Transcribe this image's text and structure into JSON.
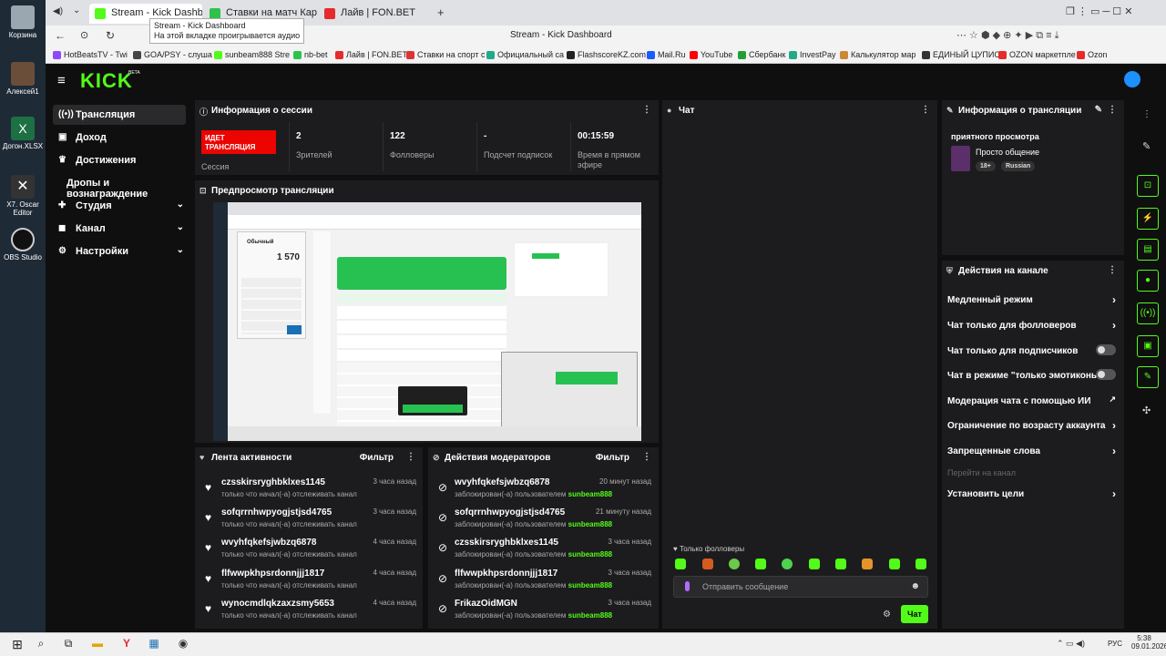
{
  "desktop": {
    "icons": [
      {
        "label": "Корзина"
      },
      {
        "label": "Алексей1"
      },
      {
        "label": "Догон.XLSX"
      },
      {
        "label": "X7. Oscar Editor"
      },
      {
        "label": "OBS Studio"
      }
    ]
  },
  "browser": {
    "tabs": [
      {
        "label": "Stream - Kick Dashboard"
      },
      {
        "label": "Ставки на матч Каролин"
      },
      {
        "label": "Лайв | FON.BET"
      }
    ],
    "tooltip": {
      "line1": "Stream - Kick Dashboard",
      "line2": "На этой вкладке проигрывается аудио"
    },
    "page_title": "Stream - Kick Dashboard",
    "bookmarks": [
      "HotBeatsTV - Twi",
      "GOA/PSY - слуша",
      "sunbeam888 Stre",
      "nb-bet",
      "Лайв | FON.BET",
      "Ставки на спорт с",
      "Официальный са",
      "FlashscoreKZ.com",
      "Mail.Ru",
      "YouTube",
      "Сбербанк",
      "InvestPay",
      "Калькулятор мар",
      "ЕДИНЫЙ ЦУПИС",
      "OZON маркетпле",
      "Ozon"
    ]
  },
  "colors": {
    "accent": "#53fc18",
    "live": "#eb0400",
    "panel": "#1c1c1e",
    "bg": "#0f0f10"
  },
  "kick": {
    "logo": "KICK",
    "logo_beta": "BETA",
    "nav": [
      {
        "label": "Трансляция",
        "icon": "broadcast-icon"
      },
      {
        "label": "Доход",
        "icon": "wallet-icon"
      },
      {
        "label": "Достижения",
        "icon": "trophy-icon"
      },
      {
        "label": "Дропы и вознаграждение",
        "icon": ""
      },
      {
        "label": "Студия",
        "icon": "studio-icon"
      },
      {
        "label": "Канал",
        "icon": "channel-icon"
      },
      {
        "label": "Настройки",
        "icon": "gear-icon"
      }
    ],
    "session": {
      "title": "Информация о сессии",
      "live_badge": "ИДЕТ ТРАНСЛЯЦИЯ",
      "session_label": "Сессия",
      "stats": [
        {
          "value": "2",
          "label": "Зрителей"
        },
        {
          "value": "122",
          "label": "Фолловеры"
        },
        {
          "value": "-",
          "label": "Подсчет подписок"
        },
        {
          "value": "00:15:59",
          "label": "Время в прямом эфире"
        }
      ]
    },
    "preview": {
      "title": "Предпросмотр трансляции",
      "calc_title": "Обычный",
      "calc_value": "1 570"
    },
    "chat": {
      "title": "Чат",
      "followers_only": "Только фолловеры",
      "placeholder": "Отправить сообщение",
      "send": "Чат"
    },
    "stream_info": {
      "title": "Информация о трансляции",
      "stream_title": "приятного просмотра",
      "category": "Просто общение",
      "tags": [
        "18+",
        "Russian"
      ]
    },
    "channel_actions": {
      "title": "Действия на канале",
      "items": [
        "Медленный режим",
        "Чат только для фолловеров",
        "Чат только для подписчиков",
        "Чат в режиме \"только эмотиконы\"",
        "Модерация чата с помощью ИИ",
        "Ограничение по возрасту аккаунта",
        "Запрещенные слова"
      ],
      "goto": "Перейти на канал",
      "set_goals": "Установить цели"
    },
    "activity": {
      "title": "Лента активности",
      "filter": "Фильтр",
      "rows": [
        {
          "name": "czsskirsryghbklxes1145",
          "sub": "только что начал(-а) отслеживать канал",
          "time": "3 часа назад"
        },
        {
          "name": "sofqrrnhwpyogjstjsd4765",
          "sub": "только что начал(-а) отслеживать канал",
          "time": "3 часа назад"
        },
        {
          "name": "wvyhfqkefsjwbzq6878",
          "sub": "только что начал(-а) отслеживать канал",
          "time": "4 часа назад"
        },
        {
          "name": "flfwwpkhpsrdonnjjj1817",
          "sub": "только что начал(-а) отслеживать канал",
          "time": "4 часа назад"
        },
        {
          "name": "wynocmdlqkzaxzsmy5653",
          "sub": "только что начал(-а) отслеживать канал",
          "time": "4 часа назад"
        }
      ]
    },
    "mod": {
      "title": "Действия модераторов",
      "filter": "Фильтр",
      "by": "заблокирован(-а) пользователем",
      "moderator": "sunbeam888",
      "rows": [
        {
          "name": "wvyhfqkefsjwbzq6878",
          "time": "20 минут назад"
        },
        {
          "name": "sofqrrnhwpyogjstjsd4765",
          "time": "21 минуту назад"
        },
        {
          "name": "czsskirsryghbklxes1145",
          "time": "3 часа назад"
        },
        {
          "name": "flfwwpkhpsrdonnjjj1817",
          "time": "3 часа назад"
        },
        {
          "name": "FrikazOidMGN",
          "time": "3 часа назад"
        }
      ]
    }
  },
  "taskbar": {
    "lang": "РУС",
    "time": "5:38",
    "date": "09.01.2026"
  }
}
